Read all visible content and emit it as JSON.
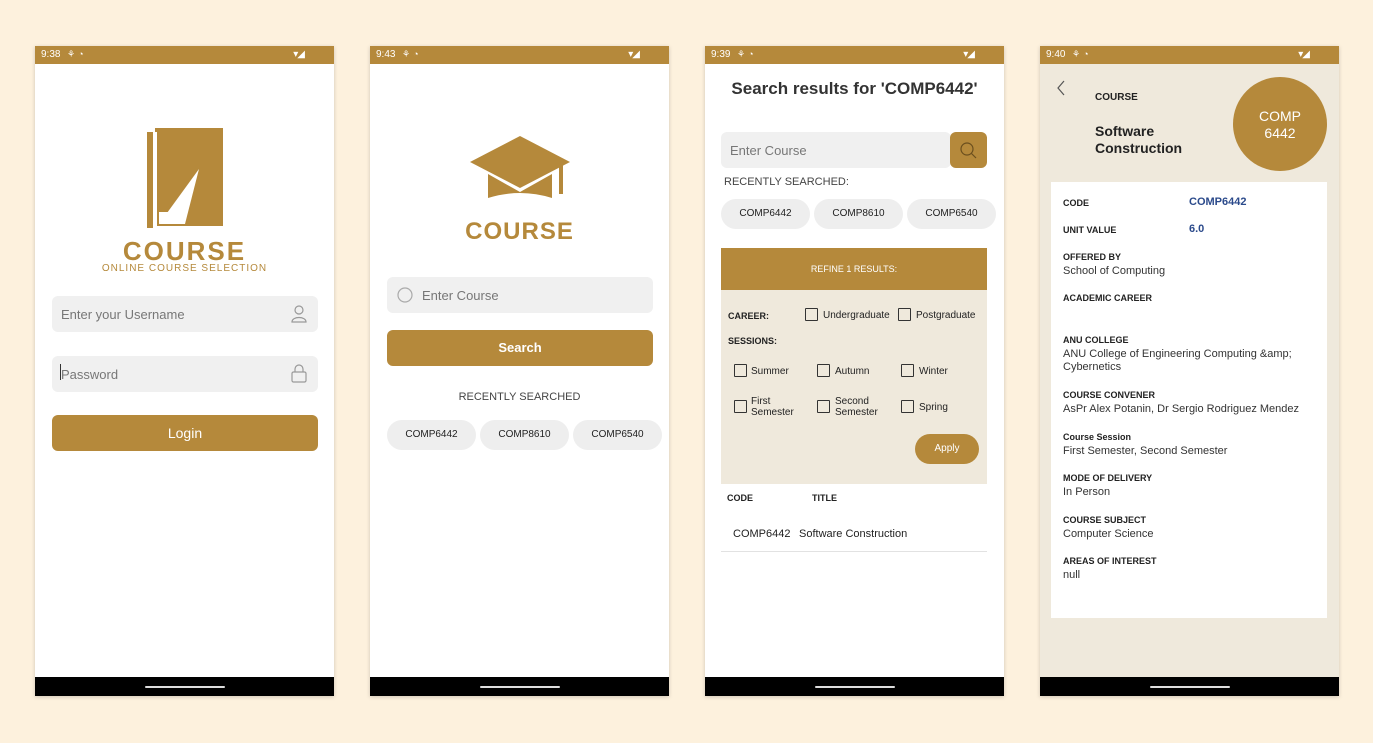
{
  "screen1": {
    "time": "9:38",
    "brand": "COURSE",
    "tagline": "ONLINE COURSE SELECTION",
    "username_placeholder": "Enter your Username",
    "password_placeholder": "Password",
    "login_label": "Login"
  },
  "screen2": {
    "time": "9:43",
    "brand": "COURSE",
    "search_placeholder": "Enter Course",
    "search_label": "Search",
    "recent_label": "RECENTLY SEARCHED",
    "recent": [
      "COMP6442",
      "COMP8610",
      "COMP6540"
    ]
  },
  "screen3": {
    "time": "9:39",
    "heading": "Search results for 'COMP6442'",
    "search_placeholder": "Enter Course",
    "recent_label": "RECENTLY SEARCHED:",
    "recent": [
      "COMP6442",
      "COMP8610",
      "COMP6540"
    ],
    "refine_label": "REFINE 1 RESULTS:",
    "career_label": "CAREER:",
    "career_options": [
      "Undergraduate",
      "Postgraduate"
    ],
    "sessions_label": "SESSIONS:",
    "session_options": [
      "Summer",
      "Autumn",
      "Winter",
      "First\nSemester",
      "Second\nSemester",
      "Spring"
    ],
    "apply_label": "Apply",
    "col_code": "CODE",
    "col_title": "TITLE",
    "result_code": "COMP6442",
    "result_title": "Software Construction"
  },
  "screen4": {
    "time": "9:40",
    "section_label": "COURSE",
    "course_name": "Software Construction",
    "badge_line1": "COMP",
    "badge_line2": "6442",
    "code_label": "CODE",
    "code_value": "COMP6442",
    "unit_label": "UNIT VALUE",
    "unit_value": "6.0",
    "offered_label": "OFFERED BY",
    "offered_value": "School of Computing",
    "career_label": "ACADEMIC CAREER",
    "college_label": "ANU COLLEGE",
    "college_value": "ANU College of Engineering Computing &amp; Cybernetics",
    "convener_label": "COURSE CONVENER",
    "convener_value": "AsPr Alex Potanin, Dr Sergio Rodriguez Mendez",
    "session_label": "Course Session",
    "session_value": "First Semester, Second Semester",
    "delivery_label": "MODE OF DELIVERY",
    "delivery_value": "In Person",
    "subject_label": "COURSE SUBJECT",
    "subject_value": "Computer Science",
    "interest_label": "AREAS OF INTEREST",
    "interest_value": "null"
  },
  "colors": {
    "accent": "#b5893b",
    "panel": "#efe9dc",
    "background": "#fdf1dd",
    "link": "#2b4a8b"
  }
}
